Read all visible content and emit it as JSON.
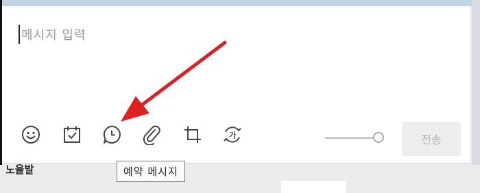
{
  "composer": {
    "placeholder": "메시지 입력",
    "send_label": "전송"
  },
  "toolbar": {
    "icons": [
      "emoji-icon",
      "calendar-check-icon",
      "clock-chat-icon",
      "paperclip-icon",
      "crop-icon",
      "translate-icon"
    ]
  },
  "tooltip": {
    "text": "예약 메시지"
  },
  "background": {
    "label": "노율발"
  },
  "colors": {
    "accent_arrow": "#e02020",
    "send_disabled_bg": "#ededed",
    "send_disabled_text": "#b3b3b3",
    "placeholder": "#9a9a9a"
  }
}
